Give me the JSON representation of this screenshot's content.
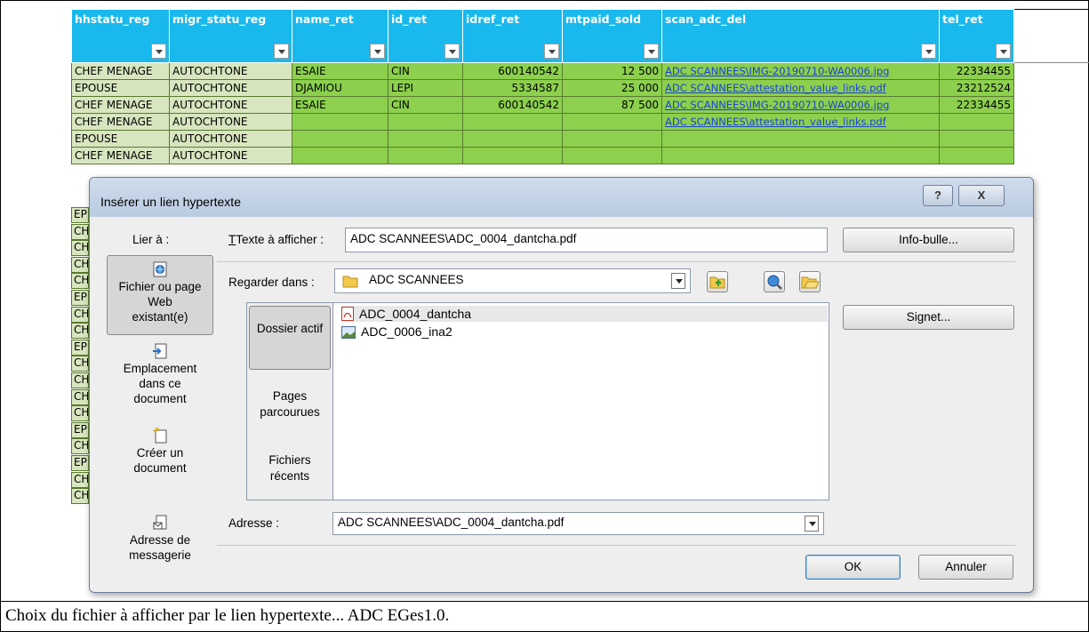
{
  "spreadsheet": {
    "headers": [
      "hhstatu_reg",
      "migr_statu_reg",
      "name_ret",
      "id_ret",
      "idref_ret",
      "mtpaid_sold",
      "scan_adc_del",
      "tel_ret"
    ],
    "rows": [
      [
        "CHEF MENAGE",
        "AUTOCHTONE",
        "ESAIE",
        "CIN",
        "600140542",
        "12 500",
        "ADC SCANNEES\\IMG-20190710-WA0006.jpg",
        "22334455"
      ],
      [
        "EPOUSE",
        "AUTOCHTONE",
        "DJAMIOU",
        "LEPI",
        "5334587",
        "25 000",
        "ADC SCANNEES\\attestation_value_links.pdf",
        "23212524"
      ],
      [
        "CHEF MENAGE",
        "AUTOCHTONE",
        "ESAIE",
        "CIN",
        "600140542",
        "87 500",
        "ADC SCANNEES\\IMG-20190710-WA0006.jpg",
        "22334455"
      ],
      [
        "CHEF MENAGE",
        "AUTOCHTONE",
        "",
        "",
        "",
        "",
        "ADC SCANNEES\\attestation_value_links.pdf",
        ""
      ],
      [
        "EPOUSE",
        "AUTOCHTONE",
        "",
        "",
        "",
        "",
        "",
        ""
      ],
      [
        "CHEF MENAGE",
        "AUTOCHTONE",
        "",
        "",
        "",
        "",
        "",
        ""
      ]
    ],
    "partial_row_labels": [
      "EP",
      "CH",
      "CH",
      "CH",
      "CH",
      "EP",
      "CH",
      "CH",
      "EP",
      "CH",
      "CH",
      "CH",
      "CH",
      "EP",
      "CH",
      "EP",
      "CH",
      "CH"
    ]
  },
  "dialog": {
    "title": "Insérer un lien hypertexte",
    "help_label": "?",
    "close_label": "X",
    "link_to_label": "Lier à :",
    "nav_items": [
      {
        "label": "Fichier ou page Web existant(e)",
        "icon": "web-file-icon"
      },
      {
        "label": "Emplacement dans ce document",
        "icon": "document-location-icon"
      },
      {
        "label": "Créer un document",
        "icon": "new-document-icon"
      },
      {
        "label": "Adresse de messagerie",
        "icon": "email-icon"
      }
    ],
    "text_to_display_label": "Texte à afficher :",
    "text_to_display_value": "ADC SCANNEES\\ADC_0004_dantcha.pdf",
    "screentip_button": "Info-bulle...",
    "look_in_label": "Regarder dans :",
    "look_in_value": "ADC SCANNEES",
    "places": [
      "Dossier actif",
      "Pages parcourues",
      "Fichiers récents"
    ],
    "files": [
      {
        "name": "ADC_0004_dantcha",
        "icon": "pdf-icon",
        "selected": true
      },
      {
        "name": "ADC_0006_ina2",
        "icon": "image-icon",
        "selected": false
      }
    ],
    "bookmark_button": "Signet...",
    "address_label": "Adresse :",
    "address_value": "ADC SCANNEES\\ADC_0004_dantcha.pdf",
    "ok_button": "OK",
    "cancel_button": "Annuler",
    "accent_color": "#19b9ee"
  },
  "caption": "Choix du fichier à afficher par le lien hypertexte... ADC EGes1.0."
}
